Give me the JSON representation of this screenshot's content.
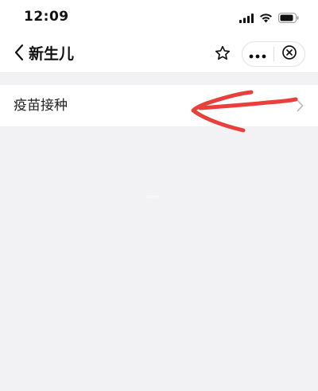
{
  "status": {
    "time": "12:09",
    "icons": [
      "signal-icon",
      "wifi-icon",
      "battery-icon"
    ]
  },
  "nav": {
    "back_icon": "chevron-left-icon",
    "title": "新生儿",
    "star_icon": "star-icon",
    "more_icon": "more-dots-icon",
    "close_icon": "close-circle-icon"
  },
  "list": {
    "items": [
      {
        "label": "疫苗接种",
        "icon": "chevron-right-icon"
      }
    ]
  },
  "annotation": {
    "type": "red-arrow",
    "color": "#e8413c"
  },
  "faint_text": "note",
  "colors": {
    "background": "#f2f2f5",
    "surface": "#ffffff",
    "text": "#111111",
    "chevron": "#b8b8b8",
    "annotation": "#e8413c"
  }
}
